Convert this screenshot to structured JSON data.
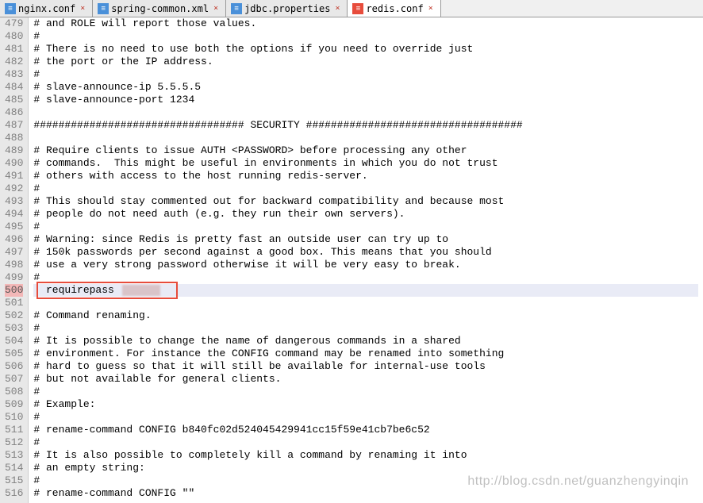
{
  "tabs": [
    {
      "label": "nginx.conf",
      "active": false,
      "iconColor": "blue"
    },
    {
      "label": "spring-common.xml",
      "active": false,
      "iconColor": "blue"
    },
    {
      "label": "jdbc.properties",
      "active": false,
      "iconColor": "blue"
    },
    {
      "label": "redis.conf",
      "active": true,
      "iconColor": "red"
    }
  ],
  "startLine": 479,
  "highlightLineNumber": 500,
  "lines": [
    "# and ROLE will report those values.",
    "#",
    "# There is no need to use both the options if you need to override just",
    "# the port or the IP address.",
    "#",
    "# slave-announce-ip 5.5.5.5",
    "# slave-announce-port 1234",
    "",
    "################################## SECURITY ###################################",
    "",
    "# Require clients to issue AUTH <PASSWORD> before processing any other",
    "# commands.  This might be useful in environments in which you do not trust",
    "# others with access to the host running redis-server.",
    "#",
    "# This should stay commented out for backward compatibility and because most",
    "# people do not need auth (e.g. they run their own servers).",
    "#",
    "# Warning: since Redis is pretty fast an outside user can try up to",
    "# 150k passwords per second against a good box. This means that you should",
    "# use a very strong password otherwise it will be very easy to break.",
    "#",
    "  requirepass ",
    "",
    "# Command renaming.",
    "#",
    "# It is possible to change the name of dangerous commands in a shared",
    "# environment. For instance the CONFIG command may be renamed into something",
    "# hard to guess so that it will still be available for internal-use tools",
    "# but not available for general clients.",
    "#",
    "# Example:",
    "#",
    "# rename-command CONFIG b840fc02d524045429941cc15f59e41cb7be6c52",
    "#",
    "# It is also possible to completely kill a command by renaming it into",
    "# an empty string:",
    "#",
    "# rename-command CONFIG \"\""
  ],
  "watermark": "http://blog.csdn.net/guanzhengyinqin"
}
